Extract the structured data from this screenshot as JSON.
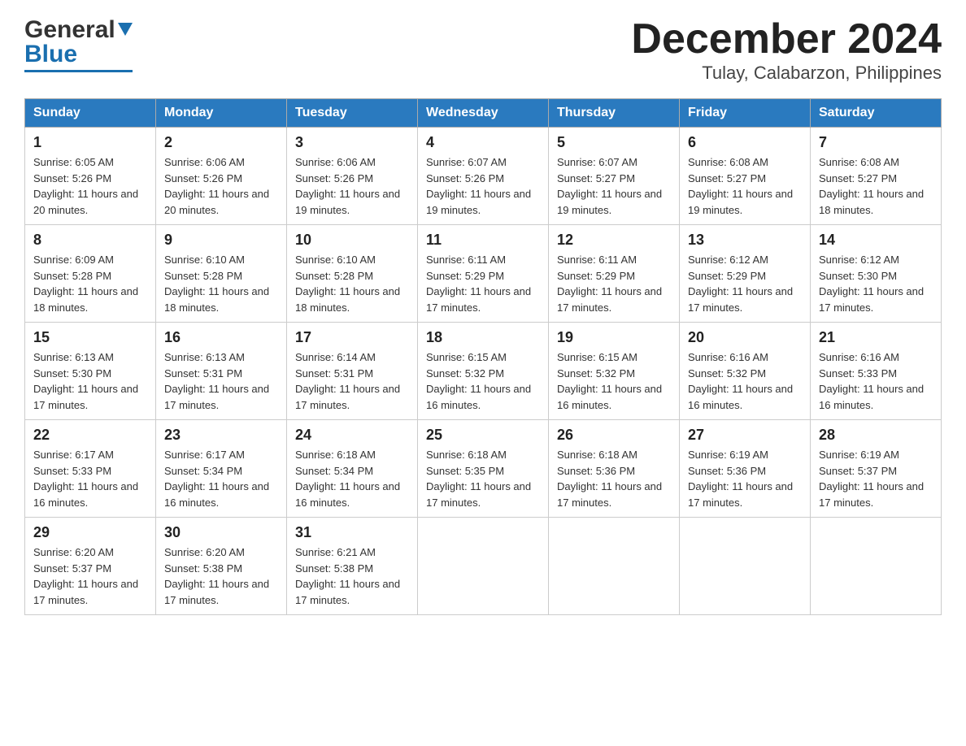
{
  "header": {
    "logo_general": "General",
    "logo_blue": "Blue",
    "title": "December 2024",
    "location": "Tulay, Calabarzon, Philippines"
  },
  "days_of_week": [
    "Sunday",
    "Monday",
    "Tuesday",
    "Wednesday",
    "Thursday",
    "Friday",
    "Saturday"
  ],
  "weeks": [
    [
      {
        "day": "1",
        "sunrise": "6:05 AM",
        "sunset": "5:26 PM",
        "daylight": "11 hours and 20 minutes."
      },
      {
        "day": "2",
        "sunrise": "6:06 AM",
        "sunset": "5:26 PM",
        "daylight": "11 hours and 20 minutes."
      },
      {
        "day": "3",
        "sunrise": "6:06 AM",
        "sunset": "5:26 PM",
        "daylight": "11 hours and 19 minutes."
      },
      {
        "day": "4",
        "sunrise": "6:07 AM",
        "sunset": "5:26 PM",
        "daylight": "11 hours and 19 minutes."
      },
      {
        "day": "5",
        "sunrise": "6:07 AM",
        "sunset": "5:27 PM",
        "daylight": "11 hours and 19 minutes."
      },
      {
        "day": "6",
        "sunrise": "6:08 AM",
        "sunset": "5:27 PM",
        "daylight": "11 hours and 19 minutes."
      },
      {
        "day": "7",
        "sunrise": "6:08 AM",
        "sunset": "5:27 PM",
        "daylight": "11 hours and 18 minutes."
      }
    ],
    [
      {
        "day": "8",
        "sunrise": "6:09 AM",
        "sunset": "5:28 PM",
        "daylight": "11 hours and 18 minutes."
      },
      {
        "day": "9",
        "sunrise": "6:10 AM",
        "sunset": "5:28 PM",
        "daylight": "11 hours and 18 minutes."
      },
      {
        "day": "10",
        "sunrise": "6:10 AM",
        "sunset": "5:28 PM",
        "daylight": "11 hours and 18 minutes."
      },
      {
        "day": "11",
        "sunrise": "6:11 AM",
        "sunset": "5:29 PM",
        "daylight": "11 hours and 17 minutes."
      },
      {
        "day": "12",
        "sunrise": "6:11 AM",
        "sunset": "5:29 PM",
        "daylight": "11 hours and 17 minutes."
      },
      {
        "day": "13",
        "sunrise": "6:12 AM",
        "sunset": "5:29 PM",
        "daylight": "11 hours and 17 minutes."
      },
      {
        "day": "14",
        "sunrise": "6:12 AM",
        "sunset": "5:30 PM",
        "daylight": "11 hours and 17 minutes."
      }
    ],
    [
      {
        "day": "15",
        "sunrise": "6:13 AM",
        "sunset": "5:30 PM",
        "daylight": "11 hours and 17 minutes."
      },
      {
        "day": "16",
        "sunrise": "6:13 AM",
        "sunset": "5:31 PM",
        "daylight": "11 hours and 17 minutes."
      },
      {
        "day": "17",
        "sunrise": "6:14 AM",
        "sunset": "5:31 PM",
        "daylight": "11 hours and 17 minutes."
      },
      {
        "day": "18",
        "sunrise": "6:15 AM",
        "sunset": "5:32 PM",
        "daylight": "11 hours and 16 minutes."
      },
      {
        "day": "19",
        "sunrise": "6:15 AM",
        "sunset": "5:32 PM",
        "daylight": "11 hours and 16 minutes."
      },
      {
        "day": "20",
        "sunrise": "6:16 AM",
        "sunset": "5:32 PM",
        "daylight": "11 hours and 16 minutes."
      },
      {
        "day": "21",
        "sunrise": "6:16 AM",
        "sunset": "5:33 PM",
        "daylight": "11 hours and 16 minutes."
      }
    ],
    [
      {
        "day": "22",
        "sunrise": "6:17 AM",
        "sunset": "5:33 PM",
        "daylight": "11 hours and 16 minutes."
      },
      {
        "day": "23",
        "sunrise": "6:17 AM",
        "sunset": "5:34 PM",
        "daylight": "11 hours and 16 minutes."
      },
      {
        "day": "24",
        "sunrise": "6:18 AM",
        "sunset": "5:34 PM",
        "daylight": "11 hours and 16 minutes."
      },
      {
        "day": "25",
        "sunrise": "6:18 AM",
        "sunset": "5:35 PM",
        "daylight": "11 hours and 17 minutes."
      },
      {
        "day": "26",
        "sunrise": "6:18 AM",
        "sunset": "5:36 PM",
        "daylight": "11 hours and 17 minutes."
      },
      {
        "day": "27",
        "sunrise": "6:19 AM",
        "sunset": "5:36 PM",
        "daylight": "11 hours and 17 minutes."
      },
      {
        "day": "28",
        "sunrise": "6:19 AM",
        "sunset": "5:37 PM",
        "daylight": "11 hours and 17 minutes."
      }
    ],
    [
      {
        "day": "29",
        "sunrise": "6:20 AM",
        "sunset": "5:37 PM",
        "daylight": "11 hours and 17 minutes."
      },
      {
        "day": "30",
        "sunrise": "6:20 AM",
        "sunset": "5:38 PM",
        "daylight": "11 hours and 17 minutes."
      },
      {
        "day": "31",
        "sunrise": "6:21 AM",
        "sunset": "5:38 PM",
        "daylight": "11 hours and 17 minutes."
      },
      null,
      null,
      null,
      null
    ]
  ],
  "labels": {
    "sunrise": "Sunrise:",
    "sunset": "Sunset:",
    "daylight": "Daylight:"
  }
}
